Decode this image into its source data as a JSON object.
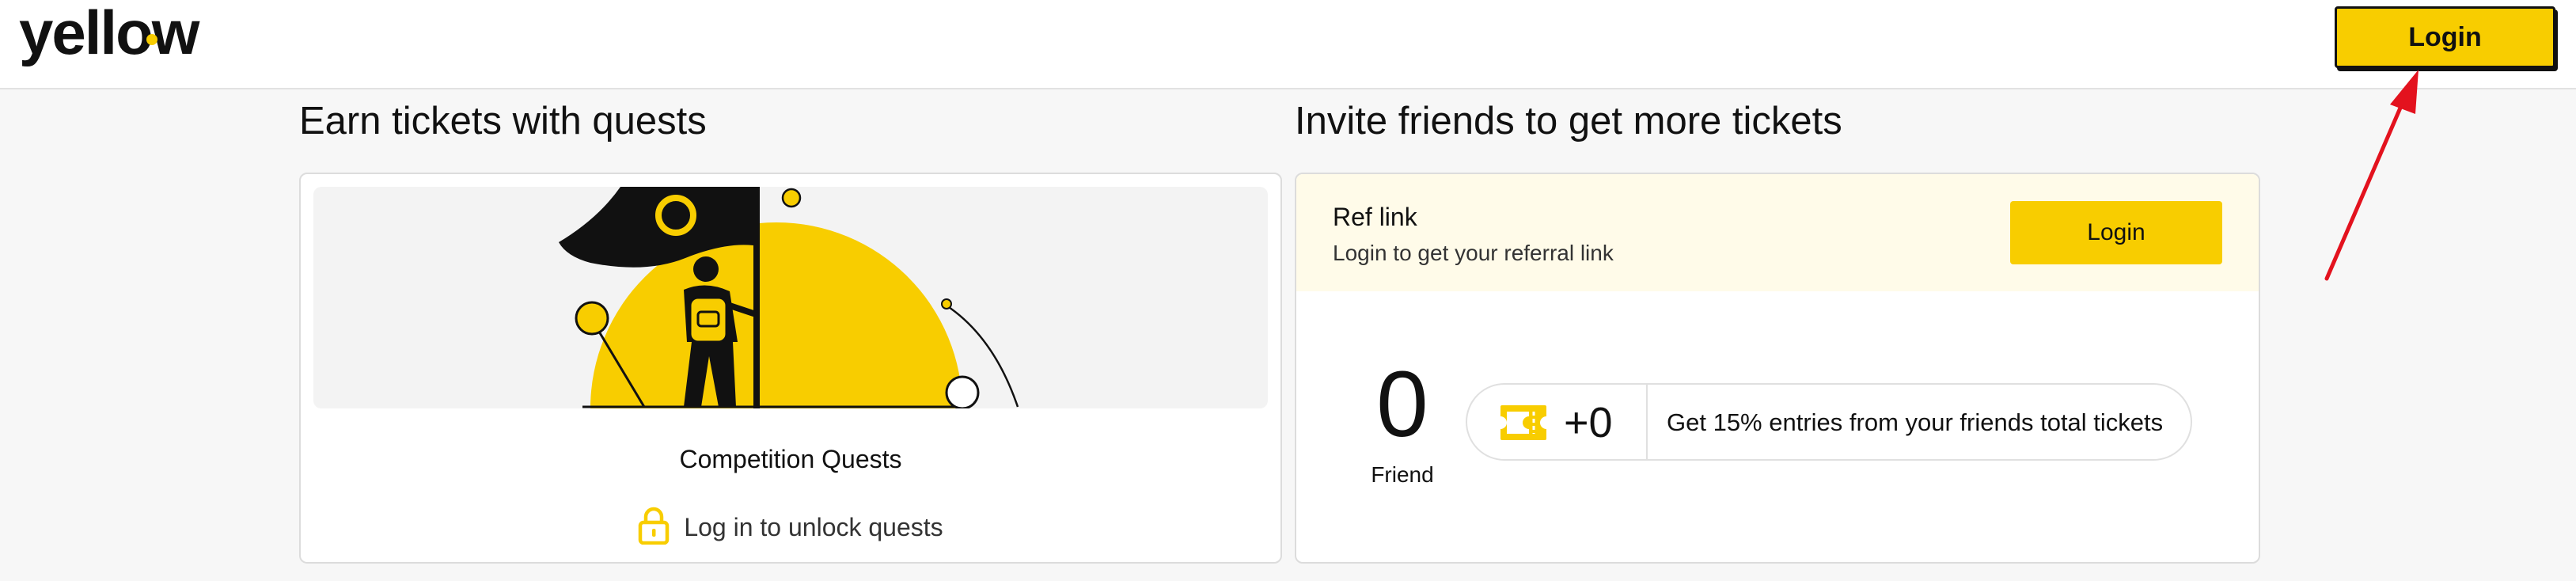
{
  "header": {
    "logo_text": "yellow",
    "login_label": "Login"
  },
  "quests": {
    "title": "Earn tickets with quests",
    "card_title": "Competition Quests",
    "unlock_label": "Log in to unlock quests"
  },
  "invite": {
    "title": "Invite friends to get more tickets",
    "ref_title": "Ref link",
    "ref_subtitle": "Login to get your referral link",
    "login_label": "Login",
    "friend_count": "0",
    "friend_label": "Friend",
    "bonus_value": "+0",
    "bonus_description": "Get 15% entries from your friends total tickets"
  },
  "colors": {
    "accent": "#f8cd00",
    "annotation_arrow": "#e3121e"
  }
}
